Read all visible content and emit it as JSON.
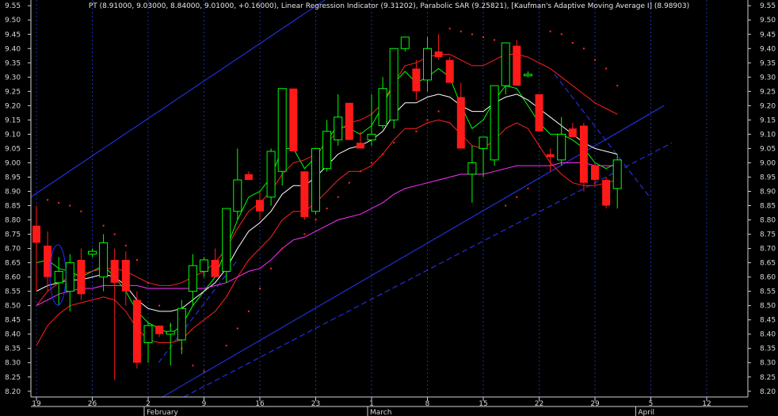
{
  "chart_data": {
    "type": "candlestick",
    "title": "PT (8.91000, 9.03000, 8.84000, 9.01000, +0.16000), Linear Regression Indicator (9.31202), Parabolic SAR (9.25821), [Kaufman's Adaptive Moving Average I] (8.98903)",
    "y_axis": {
      "min": 8.18,
      "max": 9.57,
      "ticks": [
        8.2,
        8.25,
        8.3,
        8.35,
        8.4,
        8.45,
        8.5,
        8.55,
        8.6,
        8.65,
        8.7,
        8.75,
        8.8,
        8.85,
        8.9,
        8.95,
        9.0,
        9.05,
        9.1,
        9.15,
        9.2,
        9.25,
        9.3,
        9.35,
        9.4,
        9.45,
        9.5,
        9.55
      ],
      "tick_labels": [
        "8.20",
        "8.25",
        "8.30",
        "8.35",
        "8.40",
        "8.45",
        "8.50",
        "8.55",
        "8.60",
        "8.65",
        "8.70",
        "8.75",
        "8.80",
        "8.85",
        "8.90",
        "8.95",
        "9.00",
        "9.05",
        "9.10",
        "9.15",
        "9.20",
        "9.25",
        "9.30",
        "9.35",
        "9.40",
        "9.45",
        "9.50",
        "9.55"
      ],
      "position": "both"
    },
    "x_axis": {
      "day_labels": [
        {
          "i": 0,
          "text": "19"
        },
        {
          "i": 5,
          "text": "26"
        },
        {
          "i": 10,
          "text": "2"
        },
        {
          "i": 15,
          "text": "9"
        },
        {
          "i": 20,
          "text": "16"
        },
        {
          "i": 25,
          "text": "23"
        },
        {
          "i": 30,
          "text": "1"
        },
        {
          "i": 35,
          "text": "8"
        },
        {
          "i": 40,
          "text": "15"
        },
        {
          "i": 45,
          "text": "22"
        },
        {
          "i": 50,
          "text": "29"
        },
        {
          "i": 55,
          "text": "5"
        },
        {
          "i": 60,
          "text": "12"
        }
      ],
      "month_labels": [
        {
          "i": 10,
          "text": "February"
        },
        {
          "i": 30,
          "text": "March"
        },
        {
          "i": 54,
          "text": "April"
        }
      ]
    },
    "grid": true,
    "candles": [
      {
        "o": 8.78,
        "h": 8.85,
        "l": 8.55,
        "c": 8.72
      },
      {
        "o": 8.71,
        "h": 8.76,
        "l": 8.55,
        "c": 8.6
      },
      {
        "o": 8.58,
        "h": 8.67,
        "l": 8.5,
        "c": 8.62
      },
      {
        "o": 8.55,
        "h": 8.68,
        "l": 8.48,
        "c": 8.65
      },
      {
        "o": 8.66,
        "h": 8.7,
        "l": 8.52,
        "c": 8.54
      },
      {
        "o": 8.68,
        "h": 8.7,
        "l": 8.67,
        "c": 8.69
      },
      {
        "o": 8.6,
        "h": 8.75,
        "l": 8.55,
        "c": 8.72
      },
      {
        "o": 8.66,
        "h": 8.7,
        "l": 8.24,
        "c": 8.58
      },
      {
        "o": 8.66,
        "h": 8.69,
        "l": 8.5,
        "c": 8.55
      },
      {
        "o": 8.52,
        "h": 8.55,
        "l": 8.28,
        "c": 8.3
      },
      {
        "o": 8.37,
        "h": 8.44,
        "l": 8.3,
        "c": 8.43
      },
      {
        "o": 8.43,
        "h": 8.43,
        "l": 8.39,
        "c": 8.4
      },
      {
        "o": 8.4,
        "h": 8.44,
        "l": 8.29,
        "c": 8.41
      },
      {
        "o": 8.38,
        "h": 8.52,
        "l": 8.33,
        "c": 8.49
      },
      {
        "o": 8.55,
        "h": 8.68,
        "l": 8.5,
        "c": 8.64
      },
      {
        "o": 8.62,
        "h": 8.67,
        "l": 8.6,
        "c": 8.66
      },
      {
        "o": 8.66,
        "h": 8.7,
        "l": 8.6,
        "c": 8.6
      },
      {
        "o": 8.62,
        "h": 8.84,
        "l": 8.58,
        "c": 8.84
      },
      {
        "o": 8.83,
        "h": 9.05,
        "l": 8.8,
        "c": 8.94
      },
      {
        "o": 8.96,
        "h": 8.97,
        "l": 8.94,
        "c": 8.94
      },
      {
        "o": 8.87,
        "h": 8.9,
        "l": 8.8,
        "c": 8.83
      },
      {
        "o": 8.88,
        "h": 9.05,
        "l": 8.85,
        "c": 9.04
      },
      {
        "o": 8.97,
        "h": 9.26,
        "l": 8.92,
        "c": 9.26
      },
      {
        "o": 9.26,
        "h": 9.26,
        "l": 9.04,
        "c": 9.04
      },
      {
        "o": 8.97,
        "h": 8.97,
        "l": 8.8,
        "c": 8.81
      },
      {
        "o": 8.83,
        "h": 9.05,
        "l": 8.82,
        "c": 9.05
      },
      {
        "o": 8.98,
        "h": 9.15,
        "l": 8.97,
        "c": 9.11
      },
      {
        "o": 9.08,
        "h": 9.24,
        "l": 9.06,
        "c": 9.16
      },
      {
        "o": 9.21,
        "h": 9.21,
        "l": 9.08,
        "c": 9.08
      },
      {
        "o": 9.07,
        "h": 9.11,
        "l": 9.05,
        "c": 9.05
      },
      {
        "o": 9.08,
        "h": 9.24,
        "l": 9.06,
        "c": 9.1
      },
      {
        "o": 9.13,
        "h": 9.3,
        "l": 9.12,
        "c": 9.26
      },
      {
        "o": 9.15,
        "h": 9.4,
        "l": 9.12,
        "c": 9.4
      },
      {
        "o": 9.4,
        "h": 9.44,
        "l": 9.39,
        "c": 9.44
      },
      {
        "o": 9.33,
        "h": 9.36,
        "l": 9.22,
        "c": 9.25
      },
      {
        "o": 9.29,
        "h": 9.44,
        "l": 9.25,
        "c": 9.4
      },
      {
        "o": 9.39,
        "h": 9.45,
        "l": 9.36,
        "c": 9.37
      },
      {
        "o": 9.36,
        "h": 9.37,
        "l": 9.28,
        "c": 9.28
      },
      {
        "o": 9.23,
        "h": 9.28,
        "l": 9.05,
        "c": 9.05
      },
      {
        "o": 8.96,
        "h": 9.06,
        "l": 8.86,
        "c": 9.0
      },
      {
        "o": 9.05,
        "h": 9.09,
        "l": 8.95,
        "c": 9.09
      },
      {
        "o": 9.01,
        "h": 9.27,
        "l": 8.99,
        "c": 9.27
      },
      {
        "o": 9.27,
        "h": 9.42,
        "l": 9.24,
        "c": 9.42
      },
      {
        "o": 9.41,
        "h": 9.43,
        "l": 9.27,
        "c": 9.27
      },
      {
        "o": 9.31,
        "h": 9.32,
        "l": 9.3,
        "c": 9.31
      },
      {
        "o": 9.24,
        "h": 9.24,
        "l": 9.11,
        "c": 9.11
      },
      {
        "o": 9.03,
        "h": 9.05,
        "l": 8.97,
        "c": 9.02
      },
      {
        "o": 9.01,
        "h": 9.16,
        "l": 8.99,
        "c": 9.1
      },
      {
        "o": 9.12,
        "h": 9.14,
        "l": 9.09,
        "c": 9.09
      },
      {
        "o": 9.13,
        "h": 9.14,
        "l": 8.9,
        "c": 8.93
      },
      {
        "o": 8.99,
        "h": 9.0,
        "l": 8.92,
        "c": 8.94
      },
      {
        "o": 8.94,
        "h": 8.95,
        "l": 8.84,
        "c": 8.85
      },
      {
        "o": 8.91,
        "h": 9.03,
        "l": 8.84,
        "c": 9.01
      }
    ],
    "series": [
      {
        "name": "Linear Regression Indicator",
        "color": "#00ff00",
        "values": [
          8.65,
          8.66,
          8.63,
          8.62,
          8.6,
          8.62,
          8.64,
          8.6,
          8.55,
          8.48,
          8.44,
          8.42,
          8.4,
          8.43,
          8.5,
          8.55,
          8.6,
          8.7,
          8.8,
          8.88,
          8.9,
          8.95,
          9.05,
          9.05,
          8.98,
          9.02,
          9.08,
          9.13,
          9.12,
          9.1,
          9.13,
          9.2,
          9.28,
          9.32,
          9.28,
          9.3,
          9.33,
          9.3,
          9.2,
          9.12,
          9.15,
          9.22,
          9.27,
          9.26,
          9.2,
          9.14,
          9.1,
          9.1,
          9.08,
          9.05,
          9.0,
          8.98,
          9.0
        ]
      },
      {
        "name": "KAMA white",
        "color": "#ffffff",
        "values": [
          8.55,
          8.57,
          8.58,
          8.59,
          8.59,
          8.6,
          8.61,
          8.6,
          8.57,
          8.52,
          8.49,
          8.48,
          8.48,
          8.49,
          8.52,
          8.55,
          8.58,
          8.63,
          8.7,
          8.76,
          8.79,
          8.83,
          8.89,
          8.92,
          8.92,
          8.95,
          8.99,
          9.03,
          9.05,
          9.06,
          9.08,
          9.11,
          9.17,
          9.21,
          9.21,
          9.23,
          9.24,
          9.23,
          9.2,
          9.18,
          9.18,
          9.21,
          9.23,
          9.24,
          9.22,
          9.19,
          9.16,
          9.13,
          9.1,
          9.07,
          9.05,
          9.04,
          9.03
        ]
      },
      {
        "name": "Band upper",
        "color": "#ff2020",
        "values": [
          8.5,
          8.55,
          8.58,
          8.6,
          8.61,
          8.62,
          8.63,
          8.63,
          8.62,
          8.6,
          8.58,
          8.57,
          8.57,
          8.58,
          8.6,
          8.62,
          8.65,
          8.7,
          8.77,
          8.83,
          8.86,
          8.9,
          8.96,
          9.0,
          9.01,
          9.03,
          9.07,
          9.11,
          9.14,
          9.15,
          9.17,
          9.21,
          9.28,
          9.34,
          9.35,
          9.37,
          9.38,
          9.38,
          9.36,
          9.34,
          9.34,
          9.36,
          9.38,
          9.38,
          9.37,
          9.35,
          9.33,
          9.3,
          9.27,
          9.24,
          9.21,
          9.19,
          9.17
        ]
      },
      {
        "name": "Band lower",
        "color": "#ff2020",
        "values": [
          8.36,
          8.43,
          8.47,
          8.5,
          8.51,
          8.52,
          8.53,
          8.52,
          8.48,
          8.42,
          8.38,
          8.37,
          8.37,
          8.38,
          8.42,
          8.45,
          8.48,
          8.53,
          8.6,
          8.66,
          8.7,
          8.74,
          8.8,
          8.83,
          8.83,
          8.86,
          8.9,
          8.94,
          8.97,
          8.97,
          8.99,
          9.03,
          9.08,
          9.12,
          9.12,
          9.14,
          9.15,
          9.14,
          9.1,
          9.06,
          9.05,
          9.08,
          9.12,
          9.14,
          9.12,
          9.06,
          9.0,
          8.96,
          8.93,
          8.92,
          8.92,
          8.93,
          8.94
        ]
      },
      {
        "name": "Magenta MA",
        "color": "#ff30ff",
        "values": [
          8.5,
          8.52,
          8.54,
          8.55,
          8.56,
          8.56,
          8.57,
          8.57,
          8.57,
          8.57,
          8.56,
          8.56,
          8.56,
          8.56,
          8.56,
          8.56,
          8.57,
          8.58,
          8.6,
          8.62,
          8.63,
          8.66,
          8.7,
          8.73,
          8.74,
          8.76,
          8.78,
          8.8,
          8.81,
          8.82,
          8.84,
          8.86,
          8.89,
          8.91,
          8.92,
          8.93,
          8.94,
          8.95,
          8.96,
          8.96,
          8.96,
          8.97,
          8.98,
          8.99,
          8.99,
          8.99,
          8.99,
          9.0,
          9.0,
          9.0,
          8.99,
          8.99,
          8.99
        ]
      }
    ],
    "sar_points": [
      [
        1,
        8.87
      ],
      [
        2,
        8.86
      ],
      [
        3,
        8.85
      ],
      [
        4,
        8.83
      ],
      [
        6,
        8.78
      ],
      [
        7,
        8.75
      ],
      [
        8,
        8.71
      ],
      [
        9,
        8.66
      ],
      [
        10,
        8.58
      ],
      [
        11,
        8.5
      ],
      [
        12,
        8.43
      ],
      [
        13,
        8.35
      ],
      [
        14,
        8.29
      ],
      [
        15,
        8.27
      ],
      [
        17,
        8.36
      ],
      [
        18,
        8.42
      ],
      [
        19,
        8.48
      ],
      [
        20,
        8.56
      ],
      [
        21,
        8.63
      ],
      [
        22,
        8.7
      ],
      [
        24,
        8.75
      ],
      [
        25,
        8.8
      ],
      [
        26,
        8.84
      ],
      [
        27,
        8.88
      ],
      [
        28,
        8.93
      ],
      [
        29,
        8.97
      ],
      [
        30,
        9.0
      ],
      [
        31,
        9.03
      ],
      [
        32,
        9.07
      ],
      [
        34,
        9.11
      ],
      [
        35,
        9.15
      ],
      [
        36,
        9.18
      ],
      [
        37,
        9.47
      ],
      [
        38,
        9.46
      ],
      [
        39,
        9.45
      ],
      [
        40,
        9.44
      ],
      [
        41,
        9.43
      ],
      [
        42,
        8.85
      ],
      [
        43,
        8.88
      ],
      [
        44,
        8.91
      ],
      [
        46,
        9.46
      ],
      [
        47,
        9.45
      ],
      [
        48,
        9.42
      ],
      [
        49,
        9.4
      ],
      [
        50,
        9.36
      ],
      [
        51,
        9.33
      ],
      [
        52,
        9.27
      ]
    ]
  }
}
